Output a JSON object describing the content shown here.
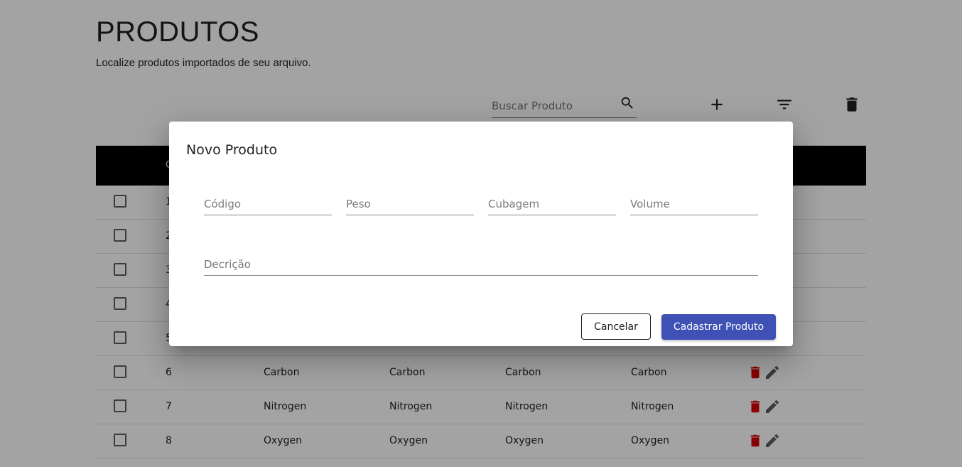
{
  "page": {
    "title": "PRODUTOS",
    "subtitle": "Localize produtos importados de seu arquivo."
  },
  "toolbar": {
    "search_placeholder": "Buscar Produto",
    "icons": [
      "search-icon",
      "add-icon",
      "filter-icon",
      "delete-icon"
    ]
  },
  "table": {
    "header": [
      "C"
    ],
    "rows": [
      {
        "id": "1",
        "cols": [
          "",
          "",
          "",
          ""
        ]
      },
      {
        "id": "2",
        "cols": [
          "",
          "",
          "",
          ""
        ]
      },
      {
        "id": "3",
        "cols": [
          "",
          "",
          "",
          ""
        ]
      },
      {
        "id": "4",
        "cols": [
          "",
          "",
          "",
          ""
        ]
      },
      {
        "id": "5",
        "cols": [
          "",
          "",
          "",
          ""
        ]
      },
      {
        "id": "6",
        "cols": [
          "Carbon",
          "Carbon",
          "Carbon",
          "Carbon"
        ]
      },
      {
        "id": "7",
        "cols": [
          "Nitrogen",
          "Nitrogen",
          "Nitrogen",
          "Nitrogen"
        ]
      },
      {
        "id": "8",
        "cols": [
          "Oxygen",
          "Oxygen",
          "Oxygen",
          "Oxygen"
        ]
      }
    ]
  },
  "dialog": {
    "title": "Novo Produto",
    "fields": {
      "codigo": "Código",
      "peso": "Peso",
      "cubagem": "Cubagem",
      "volume": "Volume",
      "descricao": "Decrição"
    },
    "cancel_label": "Cancelar",
    "submit_label": "Cadastrar Produto"
  },
  "colors": {
    "primary": "#3f51b5",
    "delete_action": "#d50000",
    "table_header": "#000000"
  }
}
